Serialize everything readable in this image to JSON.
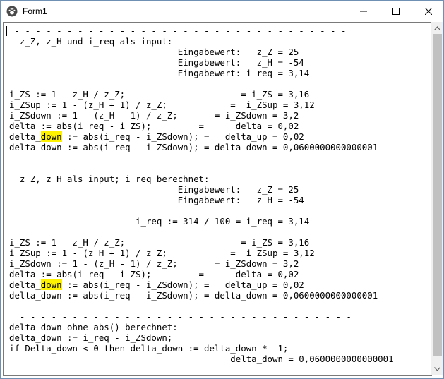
{
  "window": {
    "title": "Form1",
    "icon": "paw-icon",
    "controls": [
      "minimize-icon",
      "maximize-icon",
      "close-icon"
    ]
  },
  "memo": {
    "lines": [
      " - - - - - - - - - - - - - - - - - - - - - - - - - - - - - - - - ",
      "  z_Z, z_H und i_req als input:",
      "                                Eingabewert:   z_Z = 25",
      "                                Eingabewert:   z_H = -54",
      "                                Eingabewert: i_req = 3,14",
      "",
      "i_ZS := 1 - z_H / z_Z;                      = i_ZS = 3,16",
      "i_ZSup := 1 - (z_H + 1) / z_Z;            =  i_ZSup = 3,12",
      "i_ZSdown := 1 - (z_H - 1) / z_Z;       = i_ZSdown = 3,2",
      "delta := abs(i_req - i_ZS);         =      delta = 0,02",
      "delta_down := abs(i_req - i_ZSdown); =   delta_up = 0,02",
      "delta_down := abs(i_req - i_ZSdown); = delta_down = 0,0600000000000001",
      "",
      "  - - - - - - - - - - - - - - - - - - - - - - - - - - - - - - - - ",
      "  z_Z, z_H als input; i_req berechnet:",
      "                                Eingabewert:   z_Z = 25",
      "                                Eingabewert:   z_H = -54",
      "",
      "                        i_req := 314 / 100 = i_req = 3,14",
      "",
      "i_ZS := 1 - z_H / z_Z;                      = i_ZS = 3,16",
      "i_ZSup := 1 - (z_H + 1) / z_Z;            =  i_ZSup = 3,12",
      "i_ZSdown := 1 - (z_H - 1) / z_Z;       = i_ZSdown = 3,2",
      "delta := abs(i_req - i_ZS);         =      delta = 0,02",
      "delta_down := abs(i_req - i_ZSdown); =   delta_up = 0,02",
      "delta_down := abs(i_req - i_ZSdown); = delta_down = 0,0600000000000001",
      "",
      "  - - - - - - - - - - - - - - - - - - - - - - - - - - - - - - - - ",
      "delta_down ohne abs() berechnet:",
      "delta_down := i_req - i_ZSdown;",
      "if Delta_down < 0 then delta_down := delta_down * -1;",
      "                                          delta_down = 0,0600000000000001"
    ],
    "highlights": [
      {
        "line": 10,
        "text": "down",
        "color": "#fff200"
      },
      {
        "line": 24,
        "text": "down",
        "color": "#fff200"
      }
    ]
  },
  "scrollbar": {
    "up_icon": "scroll-up-arrow-icon",
    "down_icon": "scroll-down-arrow-icon",
    "thumb_fraction": 0.98,
    "thumb_offset_fraction": 0.0
  }
}
